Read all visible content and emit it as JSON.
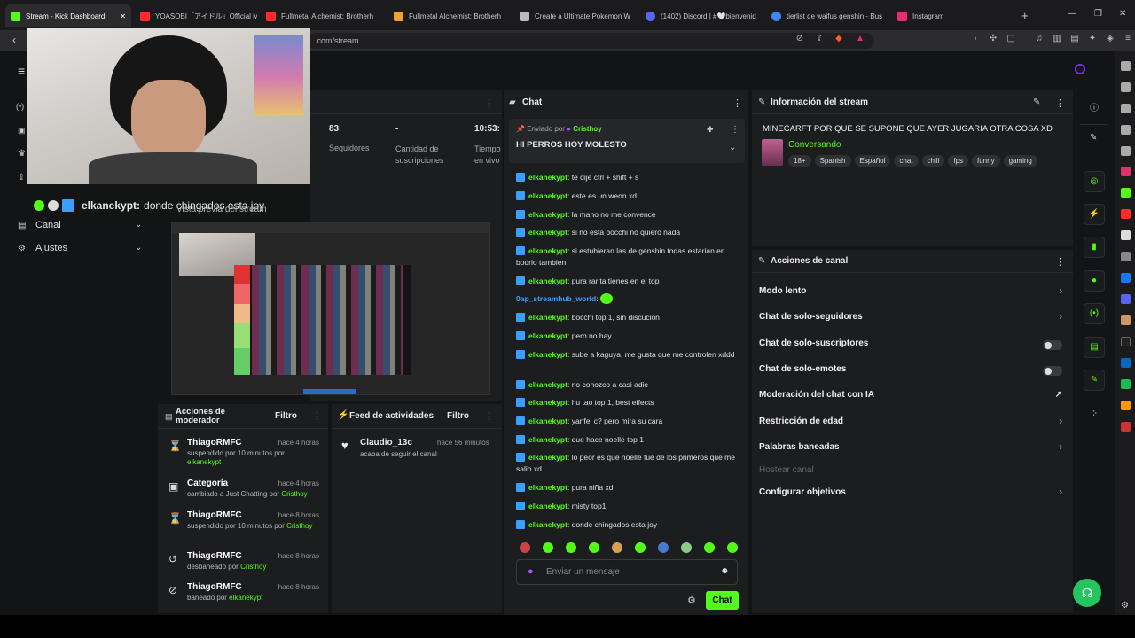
{
  "browser": {
    "tabs": [
      {
        "label": "Stream - Kick Dashboard",
        "color": "#53fc18"
      },
      {
        "label": "YOASOBI「アイドル」Official Mu",
        "color": "#ff2a2a"
      },
      {
        "label": "Fullmetal Alchemist: Brotherh",
        "color": "#ff2a2a"
      },
      {
        "label": "Fullmetal Alchemist: Brotherh",
        "color": "#f0a030"
      },
      {
        "label": "Create a Ultimate Pokemon W",
        "color": "#bbbbbb"
      },
      {
        "label": "(1402) Discord | #🤍bienvenid",
        "color": "#5865f2"
      },
      {
        "label": "tierlist de waifus genshin - Bus",
        "color": "#4285f4"
      },
      {
        "label": "Instagram",
        "color": "#e1306c"
      }
    ],
    "url": "...com/stream",
    "new_tab": "+"
  },
  "left_nav": {
    "items": [
      {
        "label": "Canal"
      },
      {
        "label": "Ajustes"
      }
    ]
  },
  "webcam_overlay": {
    "chat_user": "elkanekypt:",
    "chat_msg": "donde chingados esta joy"
  },
  "stats": {
    "followers_value": "83",
    "followers_label": "Seguidores",
    "subs_value": "-",
    "subs_label": "Cantidad de suscripciones",
    "live_value": "10:53:",
    "live_label": "Tiempo en vivo"
  },
  "preview": {
    "title": "Vista previa del stream"
  },
  "mod_actions": {
    "title": "Acciones de moderador",
    "filter": "Filtro",
    "rows": [
      {
        "icon": "hourglass-icon",
        "glyph": "⌛",
        "name": "ThiagoRMFC",
        "when": "hace 4 horas",
        "desc": "suspendido por 10 minutos por",
        "by": "elkanekypt"
      },
      {
        "icon": "category-icon",
        "glyph": "▣",
        "name": "Categoría",
        "when": "hace 4 horas",
        "desc": "cambiado a Just Chatting por",
        "by": "Cristhoy"
      },
      {
        "icon": "hourglass-icon",
        "glyph": "⌛",
        "name": "ThiagoRMFC",
        "when": "hace 8 horas",
        "desc": "suspendido por 10 minutos por",
        "by": "Cristhoy"
      },
      {
        "icon": "unban-icon",
        "glyph": "↺",
        "name": "ThiagoRMFC",
        "when": "hace 8 horas",
        "desc": "desbaneado por",
        "by": "Cristhoy"
      },
      {
        "icon": "ban-icon",
        "glyph": "⊘",
        "name": "ThiagoRMFC",
        "when": "hace 8 horas",
        "desc": "baneado por",
        "by": "elkanekypt"
      }
    ]
  },
  "activity": {
    "title": "Feed de actividades",
    "filter": "Filtro",
    "item_name": "Claudio_13c",
    "item_when": "hace 56 minutos",
    "item_desc": "acaba de seguir el canal"
  },
  "chat": {
    "title": "Chat",
    "pinned_by_label": "Enviado por",
    "pinned_by_user": "Cristhoy",
    "pinned_msg": "HI PERROS HOY MOLESTO",
    "messages": [
      {
        "user": "elkanekypt",
        "text": "te dije ctrl + shift + s"
      },
      {
        "user": "elkanekypt",
        "text": "este es un weon xd"
      },
      {
        "user": "elkanekypt",
        "text": "la mano no me convence"
      },
      {
        "user": "elkanekypt",
        "text": "si no esta bocchi no quiero nada"
      },
      {
        "user": "elkanekypt",
        "text": "si estubieran las de genshin todas estarian en bodrio tambien"
      },
      {
        "user": "elkanekypt",
        "text": "pura rarita tienes en el top"
      },
      {
        "user": "0ap_streamhub_world",
        "text": ""
      },
      {
        "user": "elkanekypt",
        "text": "bocchi top 1, sin discucion"
      },
      {
        "user": "elkanekypt",
        "text": "pero no hay"
      },
      {
        "user": "elkanekypt",
        "text": "sube a kaguya, me gusta que me controlen xddd"
      },
      {
        "user": "elkanekypt",
        "text": "no conozco a casi adie"
      },
      {
        "user": "elkanekypt",
        "text": "hu tao top 1, best effects"
      },
      {
        "user": "elkanekypt",
        "text": "yanfei c? pero mira su cara"
      },
      {
        "user": "elkanekypt",
        "text": "que hace noelle top 1"
      },
      {
        "user": "elkanekypt",
        "text": "lo peor es que noelle fue de los primeros que me salio xd"
      },
      {
        "user": "elkanekypt",
        "text": "pura niña xd"
      },
      {
        "user": "elkanekypt",
        "text": "misty top1"
      },
      {
        "user": "elkanekypt",
        "text": "donde chingados esta joy"
      }
    ],
    "input_placeholder": "Enviar un mensaje",
    "send_label": "Chat"
  },
  "stream_info": {
    "title": "Información del stream",
    "stream_title": "MINECARFT POR QUE SE SUPONE QUE AYER JUGARIA OTRA COSA XD",
    "category": "Conversando",
    "tags": [
      "18+",
      "Spanish",
      "Español",
      "chat",
      "chill",
      "fps",
      "funny",
      "gaming"
    ]
  },
  "channel_actions": {
    "title": "Acciones de canal",
    "slow": "Modo lento",
    "followers_only": "Chat de solo-seguidores",
    "subs_only": "Chat de solo-suscriptores",
    "emotes_only": "Chat de solo-emotes",
    "ai_mod": "Moderación del chat con IA",
    "age": "Restricción de edad",
    "banned": "Palabras baneadas",
    "host": "Hostear canal",
    "goals": "Configurar objetivos"
  },
  "colors": {
    "accent": "#53fc18",
    "panel": "#1c1d1f",
    "bg": "#131415"
  }
}
